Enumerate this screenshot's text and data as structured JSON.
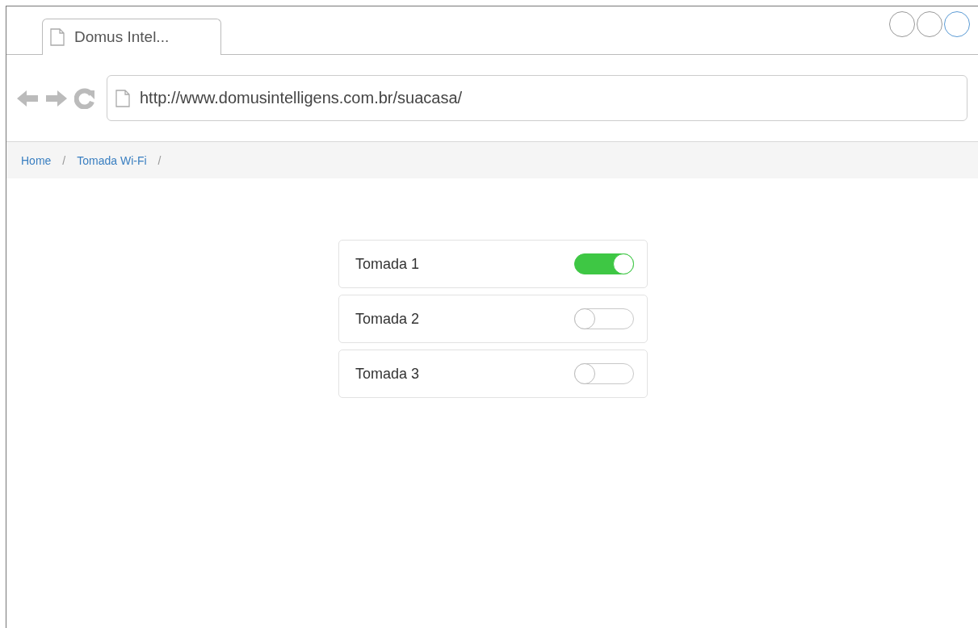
{
  "window": {
    "tabs": [
      {
        "label": "Domus Intel...",
        "selected": true
      }
    ],
    "controls": [
      {
        "highlighted": false
      },
      {
        "highlighted": false
      },
      {
        "highlighted": true
      }
    ]
  },
  "address_bar": {
    "value": "http://www.domusintelligens.com.br/suacasa/"
  },
  "breadcrumb": [
    {
      "label": "Home",
      "separator": "/"
    },
    {
      "label": "Tomada Wi-Fi",
      "separator": "/"
    }
  ],
  "sockets": [
    {
      "name": "Tomada 1",
      "on": true
    },
    {
      "name": "Tomada 2",
      "on": false
    },
    {
      "name": "Tomada 3",
      "on": false
    }
  ]
}
